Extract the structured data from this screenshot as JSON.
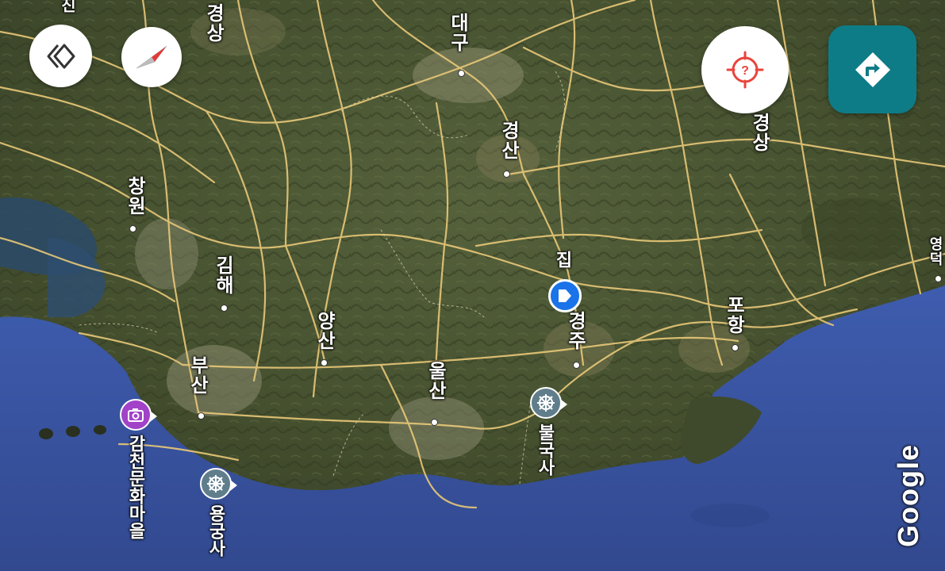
{
  "colors": {
    "land": "#4a5636",
    "sea": "#3b59a8",
    "roads": "#e8c878",
    "directions_button": "#0e7c86",
    "location_home": "#1a73e8",
    "temple_marker": "#607d8b",
    "village_marker": "#a142c8",
    "locate_icon": "#e8453c"
  },
  "map": {
    "cities": [
      {
        "id": "daegu",
        "name": "대구"
      },
      {
        "id": "gyeongsan",
        "name": "경산"
      },
      {
        "id": "changwon",
        "name": "창원"
      },
      {
        "id": "gimhae",
        "name": "김해"
      },
      {
        "id": "yangsan",
        "name": "양산"
      },
      {
        "id": "busan",
        "name": "부산"
      },
      {
        "id": "ulsan",
        "name": "울산"
      },
      {
        "id": "gyeongju",
        "name": "경주"
      },
      {
        "id": "pohang",
        "name": "포항"
      },
      {
        "id": "gyeongsang-top-left",
        "name": "경상"
      },
      {
        "id": "gyeongsang-top-right",
        "name": "경상"
      },
      {
        "id": "yeongdeok-partial",
        "name": "영덕"
      },
      {
        "id": "top-left-partial",
        "name": "진"
      }
    ],
    "home": {
      "label": "집",
      "icon": "home-icon"
    },
    "pois": [
      {
        "id": "bulguksa",
        "name": "불국사",
        "icon": "dharma-wheel-icon"
      },
      {
        "id": "yonggungsa",
        "name": "용궁사",
        "icon": "dharma-wheel-icon"
      },
      {
        "id": "gamcheon",
        "name": "감천문화마을",
        "icon": "camera-icon"
      }
    ]
  },
  "controls": {
    "layers_icon": "layers-diamond-icon",
    "compass_icon": "compass-icon",
    "locate_icon": "locate-unknown-icon",
    "directions_icon": "directions-arrow-icon"
  },
  "attribution": "Google"
}
